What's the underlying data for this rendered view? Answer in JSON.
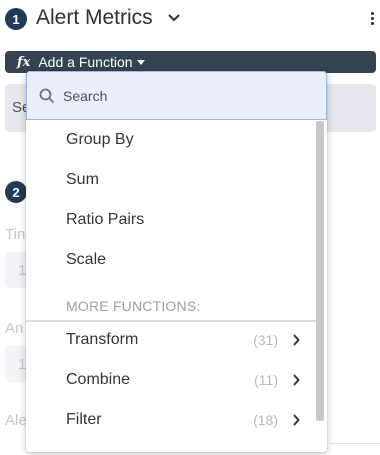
{
  "header": {
    "step1": "1",
    "title": "Alert Metrics"
  },
  "function_bar": {
    "icon_label": "fx",
    "label": "Add a Function"
  },
  "background": {
    "field1_text": "Se",
    "step2": "2",
    "label_ti": "Tin",
    "value_1a": "1",
    "label_an": "An",
    "value_1b": "1",
    "label_ale": "Ale"
  },
  "dropdown": {
    "search_placeholder": "Search",
    "items": [
      {
        "label": "Group By"
      },
      {
        "label": "Sum"
      },
      {
        "label": "Ratio Pairs"
      },
      {
        "label": "Scale"
      }
    ],
    "more_label": "MORE FUNCTIONS:",
    "more_items": [
      {
        "label": "Transform",
        "count": "(31)"
      },
      {
        "label": "Combine",
        "count": "(11)"
      },
      {
        "label": "Filter",
        "count": "(18)"
      }
    ]
  },
  "colors": {
    "badge": "#1f3b57",
    "function_bar": "#364350",
    "search_bg": "#e8f0fb",
    "search_border": "#9dbbe4"
  }
}
